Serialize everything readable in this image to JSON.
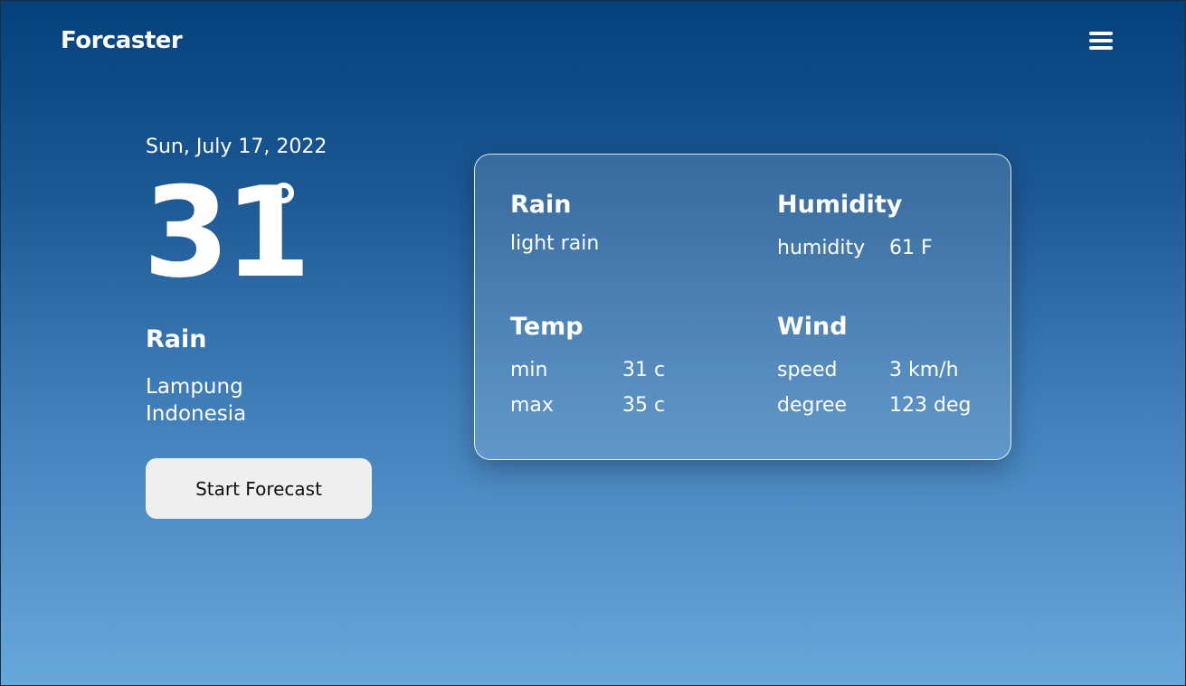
{
  "header": {
    "brand": "Forcaster",
    "menu_icon": "hamburger-menu-icon"
  },
  "current": {
    "date": "Sun, July 17, 2022",
    "temperature": "31",
    "degree_icon": "degree-icon",
    "condition": "Rain",
    "city": "Lampung",
    "country": "Indonesia",
    "button_label": "Start Forecast"
  },
  "details": {
    "rain": {
      "title": "Rain",
      "description": "light rain"
    },
    "humidity": {
      "title": "Humidity",
      "label": "humidity",
      "value": "61 F"
    },
    "temp": {
      "title": "Temp",
      "min_label": "min",
      "min_value": "31 c",
      "max_label": "max",
      "max_value": "35 c"
    },
    "wind": {
      "title": "Wind",
      "speed_label": "speed",
      "speed_value": "3 km/h",
      "degree_label": "degree",
      "degree_value": "123 deg"
    }
  },
  "colors": {
    "gradient_top": "#04407a",
    "gradient_bottom": "#67a8db",
    "button_bg": "#efefef",
    "text": "#ffffff"
  }
}
